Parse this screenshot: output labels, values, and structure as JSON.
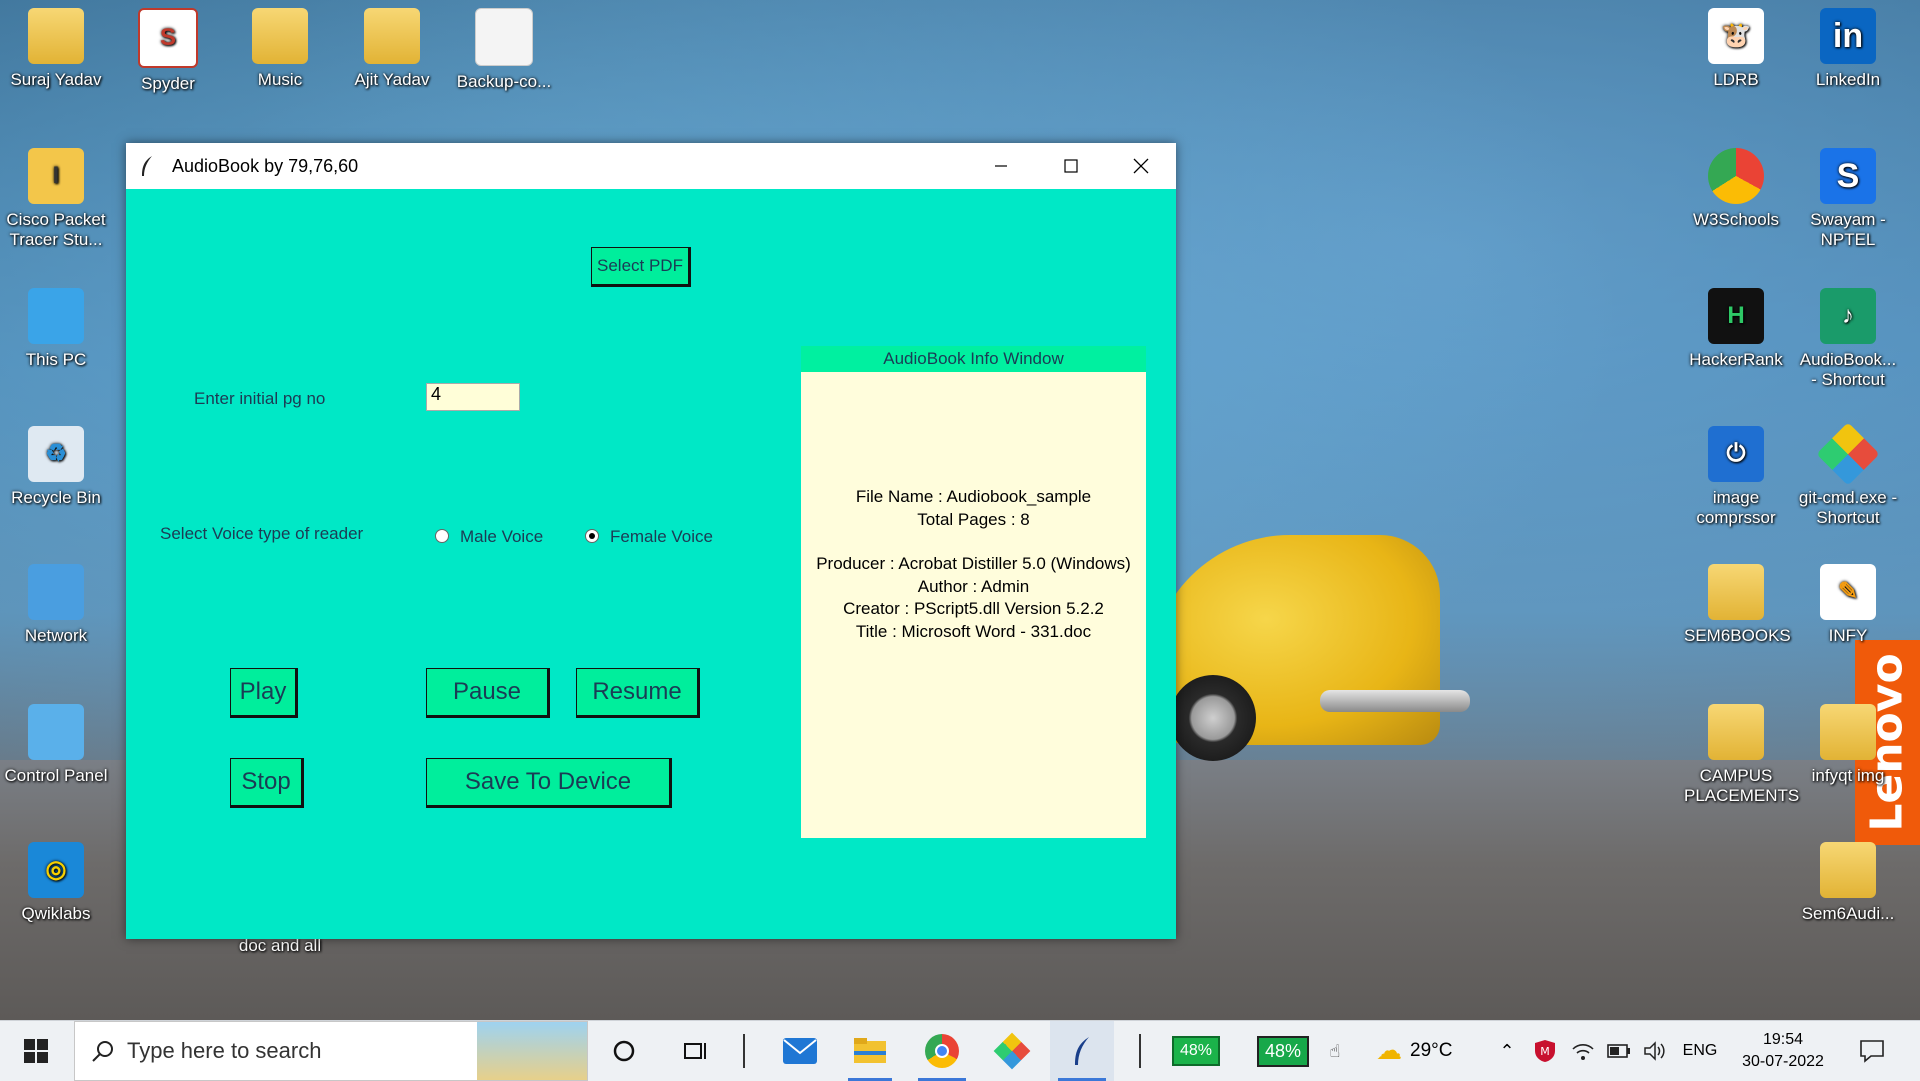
{
  "window": {
    "title": "AudioBook by 79,76,60",
    "select_pdf_label": "Select PDF",
    "page_label": "Enter initial pg no",
    "page_value": "4",
    "voice_label": "Select Voice type of reader",
    "voice_options": [
      {
        "label": "Male Voice",
        "selected": false
      },
      {
        "label": "Female Voice",
        "selected": true
      }
    ],
    "buttons": {
      "play": "Play",
      "pause": "Pause",
      "resume": "Resume",
      "stop": "Stop",
      "save": "Save To Device"
    },
    "info": {
      "header": "AudioBook Info Window",
      "file_name": "File Name : Audiobook_sample",
      "total_pages": "Total Pages : 8",
      "producer": "Producer : Acrobat Distiller 5.0 (Windows)",
      "author": "Author : Admin",
      "creator": "Creator : PScript5.dll Version 5.2.2",
      "doc_title": "Title : Microsoft Word - 331.doc"
    }
  },
  "desktop_icons": {
    "suraj": "Suraj Yadav",
    "spyder": "Spyder",
    "music": "Music",
    "ajit": "Ajit Yadav",
    "backup": "Backup-co...",
    "cisco_1": "Cisco Packet",
    "cisco_2": "Tracer Stu...",
    "this_pc": "This PC",
    "recycle": "Recycle Bin",
    "network": "Network",
    "control": "Control Panel",
    "qwiklabs": "Qwiklabs",
    "doc_and_all": "doc and all",
    "ldrb": "LDRB",
    "linkedin": "LinkedIn",
    "w3": "W3Schools",
    "swayam_1": "Swayam -",
    "swayam_2": "NPTEL",
    "hackerrank": "HackerRank",
    "audiobook_1": "AudioBook...",
    "audiobook_2": "- Shortcut",
    "image_1": "image",
    "image_2": "comprssor",
    "git_1": "git-cmd.exe -",
    "git_2": "Shortcut",
    "sem6books": "SEM6BOOKS",
    "infy": "INFY",
    "campus_1": "CAMPUS",
    "campus_2": "PLACEMENTS",
    "infyqt": "infyqt img",
    "sem6audi": "Sem6Audi..."
  },
  "brand": "Lenovo",
  "taskbar": {
    "search_placeholder": "Type here to search",
    "battery_1": "48%",
    "battery_2": "48%",
    "temperature": "29°C",
    "language": "ENG",
    "time": "19:54",
    "date": "30-07-2022"
  },
  "colors": {
    "window_bg": "#00e8c6",
    "button_bg": "#00ee9c",
    "info_bg": "#fffddc",
    "accent": "#3b78d8"
  }
}
